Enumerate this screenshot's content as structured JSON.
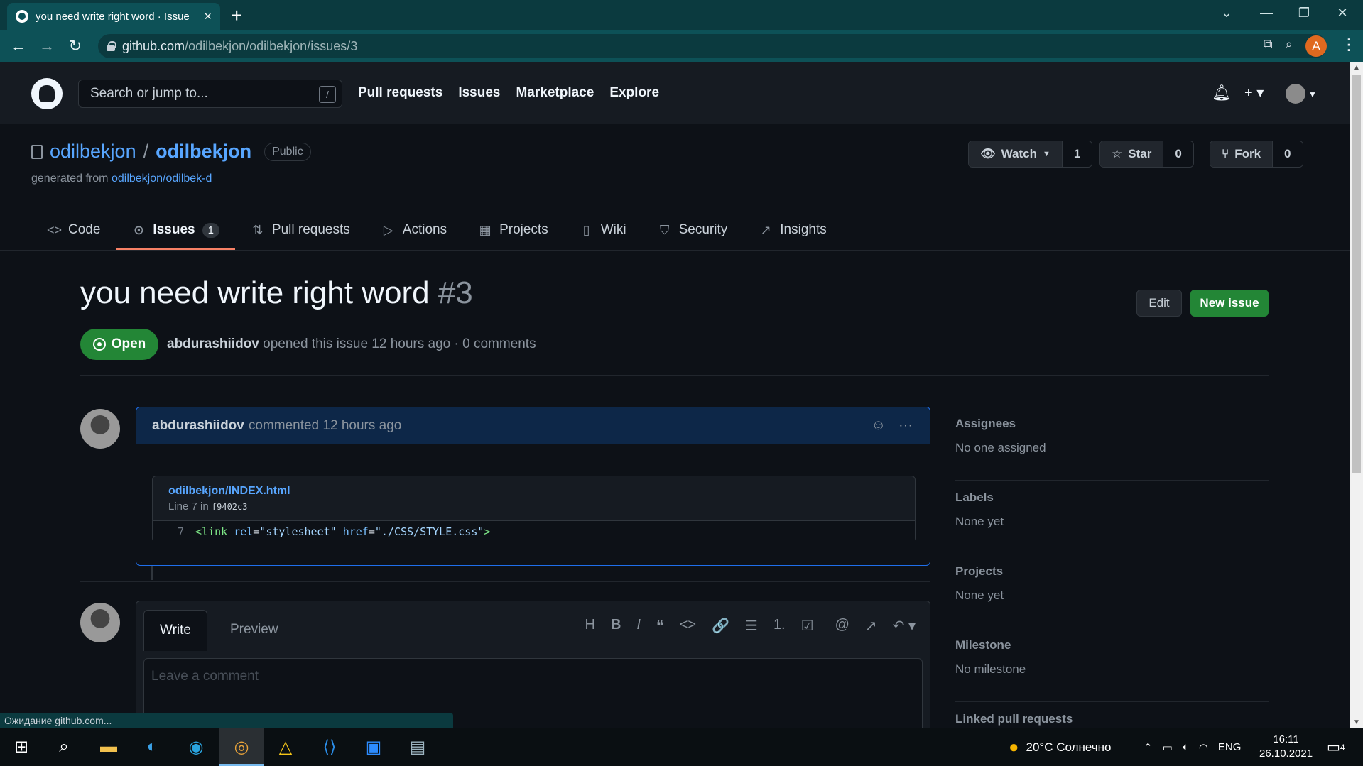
{
  "browser": {
    "tab_title": "you need write right word · Issue",
    "tab_close": "×",
    "new_tab": "+",
    "url_host": "github.com",
    "url_path": "/odilbekjon/odilbekjon/issues/3",
    "profile_initial": "A",
    "status_text": "Ожидание github.com..."
  },
  "header": {
    "search_placeholder": "Search or jump to...",
    "search_shortcut": "/",
    "nav": [
      "Pull requests",
      "Issues",
      "Marketplace",
      "Explore"
    ],
    "plus": "+ ▾"
  },
  "repo": {
    "owner": "odilbekjon",
    "separator": "/",
    "name": "odilbekjon",
    "visibility": "Public",
    "generated_prefix": "generated from",
    "generated_from": "odilbekjon/odilbek-d",
    "watch_label": "Watch",
    "watch_count": "1",
    "star_label": "Star",
    "star_count": "0",
    "fork_label": "Fork",
    "fork_count": "0"
  },
  "tabs": {
    "code": "Code",
    "issues": "Issues",
    "issues_count": "1",
    "pulls": "Pull requests",
    "actions": "Actions",
    "projects": "Projects",
    "wiki": "Wiki",
    "security": "Security",
    "insights": "Insights"
  },
  "issue": {
    "title": "you need write right word",
    "number": "#3",
    "edit_label": "Edit",
    "new_issue_label": "New issue",
    "state": "Open",
    "author": "abdurashiidov",
    "meta_text": "opened this issue 12 hours ago · 0 comments"
  },
  "comment": {
    "author": "abdurashiidov",
    "time": "commented 12 hours ago",
    "snippet_link": "odilbekjon/INDEX.html",
    "snippet_line_prefix": "Line 7 in",
    "snippet_commit": "f9402c3",
    "line_number": "7",
    "code_tag_open": "<link",
    "code_attr1": "rel",
    "code_val1": "\"stylesheet\"",
    "code_attr2": "href",
    "code_val2": "\"./CSS/STYLE.css\"",
    "code_tag_close": ">"
  },
  "editor": {
    "write_tab": "Write",
    "preview_tab": "Preview",
    "placeholder": "Leave a comment",
    "toolbar": [
      "H",
      "B",
      "I",
      "❝",
      "<>",
      "🔗",
      "☰",
      "1.",
      "☑",
      "@",
      "↗",
      "↶ ▾"
    ]
  },
  "sidebar": {
    "assignees_title": "Assignees",
    "assignees_value": "No one assigned",
    "labels_title": "Labels",
    "labels_value": "None yet",
    "projects_title": "Projects",
    "projects_value": "None yet",
    "milestone_title": "Milestone",
    "milestone_value": "No milestone",
    "linked_title": "Linked pull requests"
  },
  "taskbar": {
    "weather": "20°C Солнечно",
    "lang": "ENG",
    "time": "16:11",
    "date": "26.10.2021",
    "notifications": "4"
  },
  "colors": {
    "accent_green": "#238636",
    "link_blue": "#58a6ff",
    "tab_underline": "#f78166",
    "chrome_teal": "#0d5157"
  }
}
